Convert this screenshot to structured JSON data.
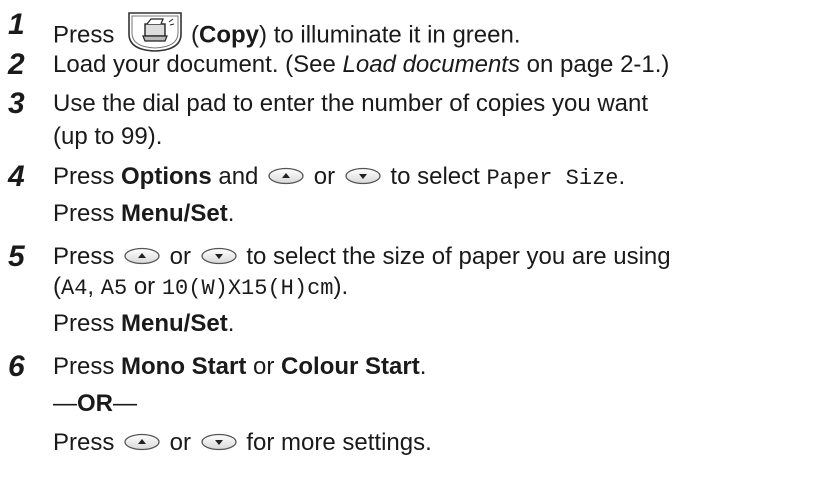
{
  "steps": [
    {
      "number": "1",
      "line1": {
        "t1": "Press",
        "copy_icon": "copy-button-icon",
        "t2": "(",
        "bold1": "Copy",
        "t3": ") to illuminate it in green."
      }
    },
    {
      "number": "2",
      "line1": {
        "t1": "Load your document. (See ",
        "italic1": "Load documents",
        "t2": " on page 2-1.)"
      }
    },
    {
      "number": "3",
      "line1": {
        "t1": "Use the dial pad to enter the number of copies you want"
      },
      "line2": {
        "t1": "(up to 99)."
      }
    },
    {
      "number": "4",
      "line1": {
        "t1": "Press ",
        "bold1": "Options",
        "t2": " and ",
        "t3": " or ",
        "t4": " to select ",
        "mono1": "Paper Size",
        "t5": "."
      },
      "line2": {
        "t1": "Press ",
        "bold1": "Menu/Set",
        "t2": "."
      }
    },
    {
      "number": "5",
      "line1": {
        "t1": "Press ",
        "t2": " or ",
        "t3": " to select the size of paper you are using"
      },
      "line2": {
        "t1": "(",
        "mono1": "A4",
        "t2": ", ",
        "mono2": "A5",
        "t3": " or ",
        "mono3": "10(W)X15(H)cm",
        "t4": ")."
      },
      "line3": {
        "t1": "Press ",
        "bold1": "Menu/Set",
        "t2": "."
      }
    },
    {
      "number": "6",
      "line1": {
        "t1": "Press ",
        "bold1": "Mono Start",
        "t2": " or ",
        "bold2": "Colour Start",
        "t3": "."
      },
      "line2": {
        "t1": "—",
        "bold1": "OR",
        "t2": "—"
      },
      "line3": {
        "t1": "Press ",
        "t2": " or ",
        "t3": " for more settings."
      }
    }
  ],
  "icons": {
    "up": "up-arrow-key-icon",
    "down": "down-arrow-key-icon"
  }
}
